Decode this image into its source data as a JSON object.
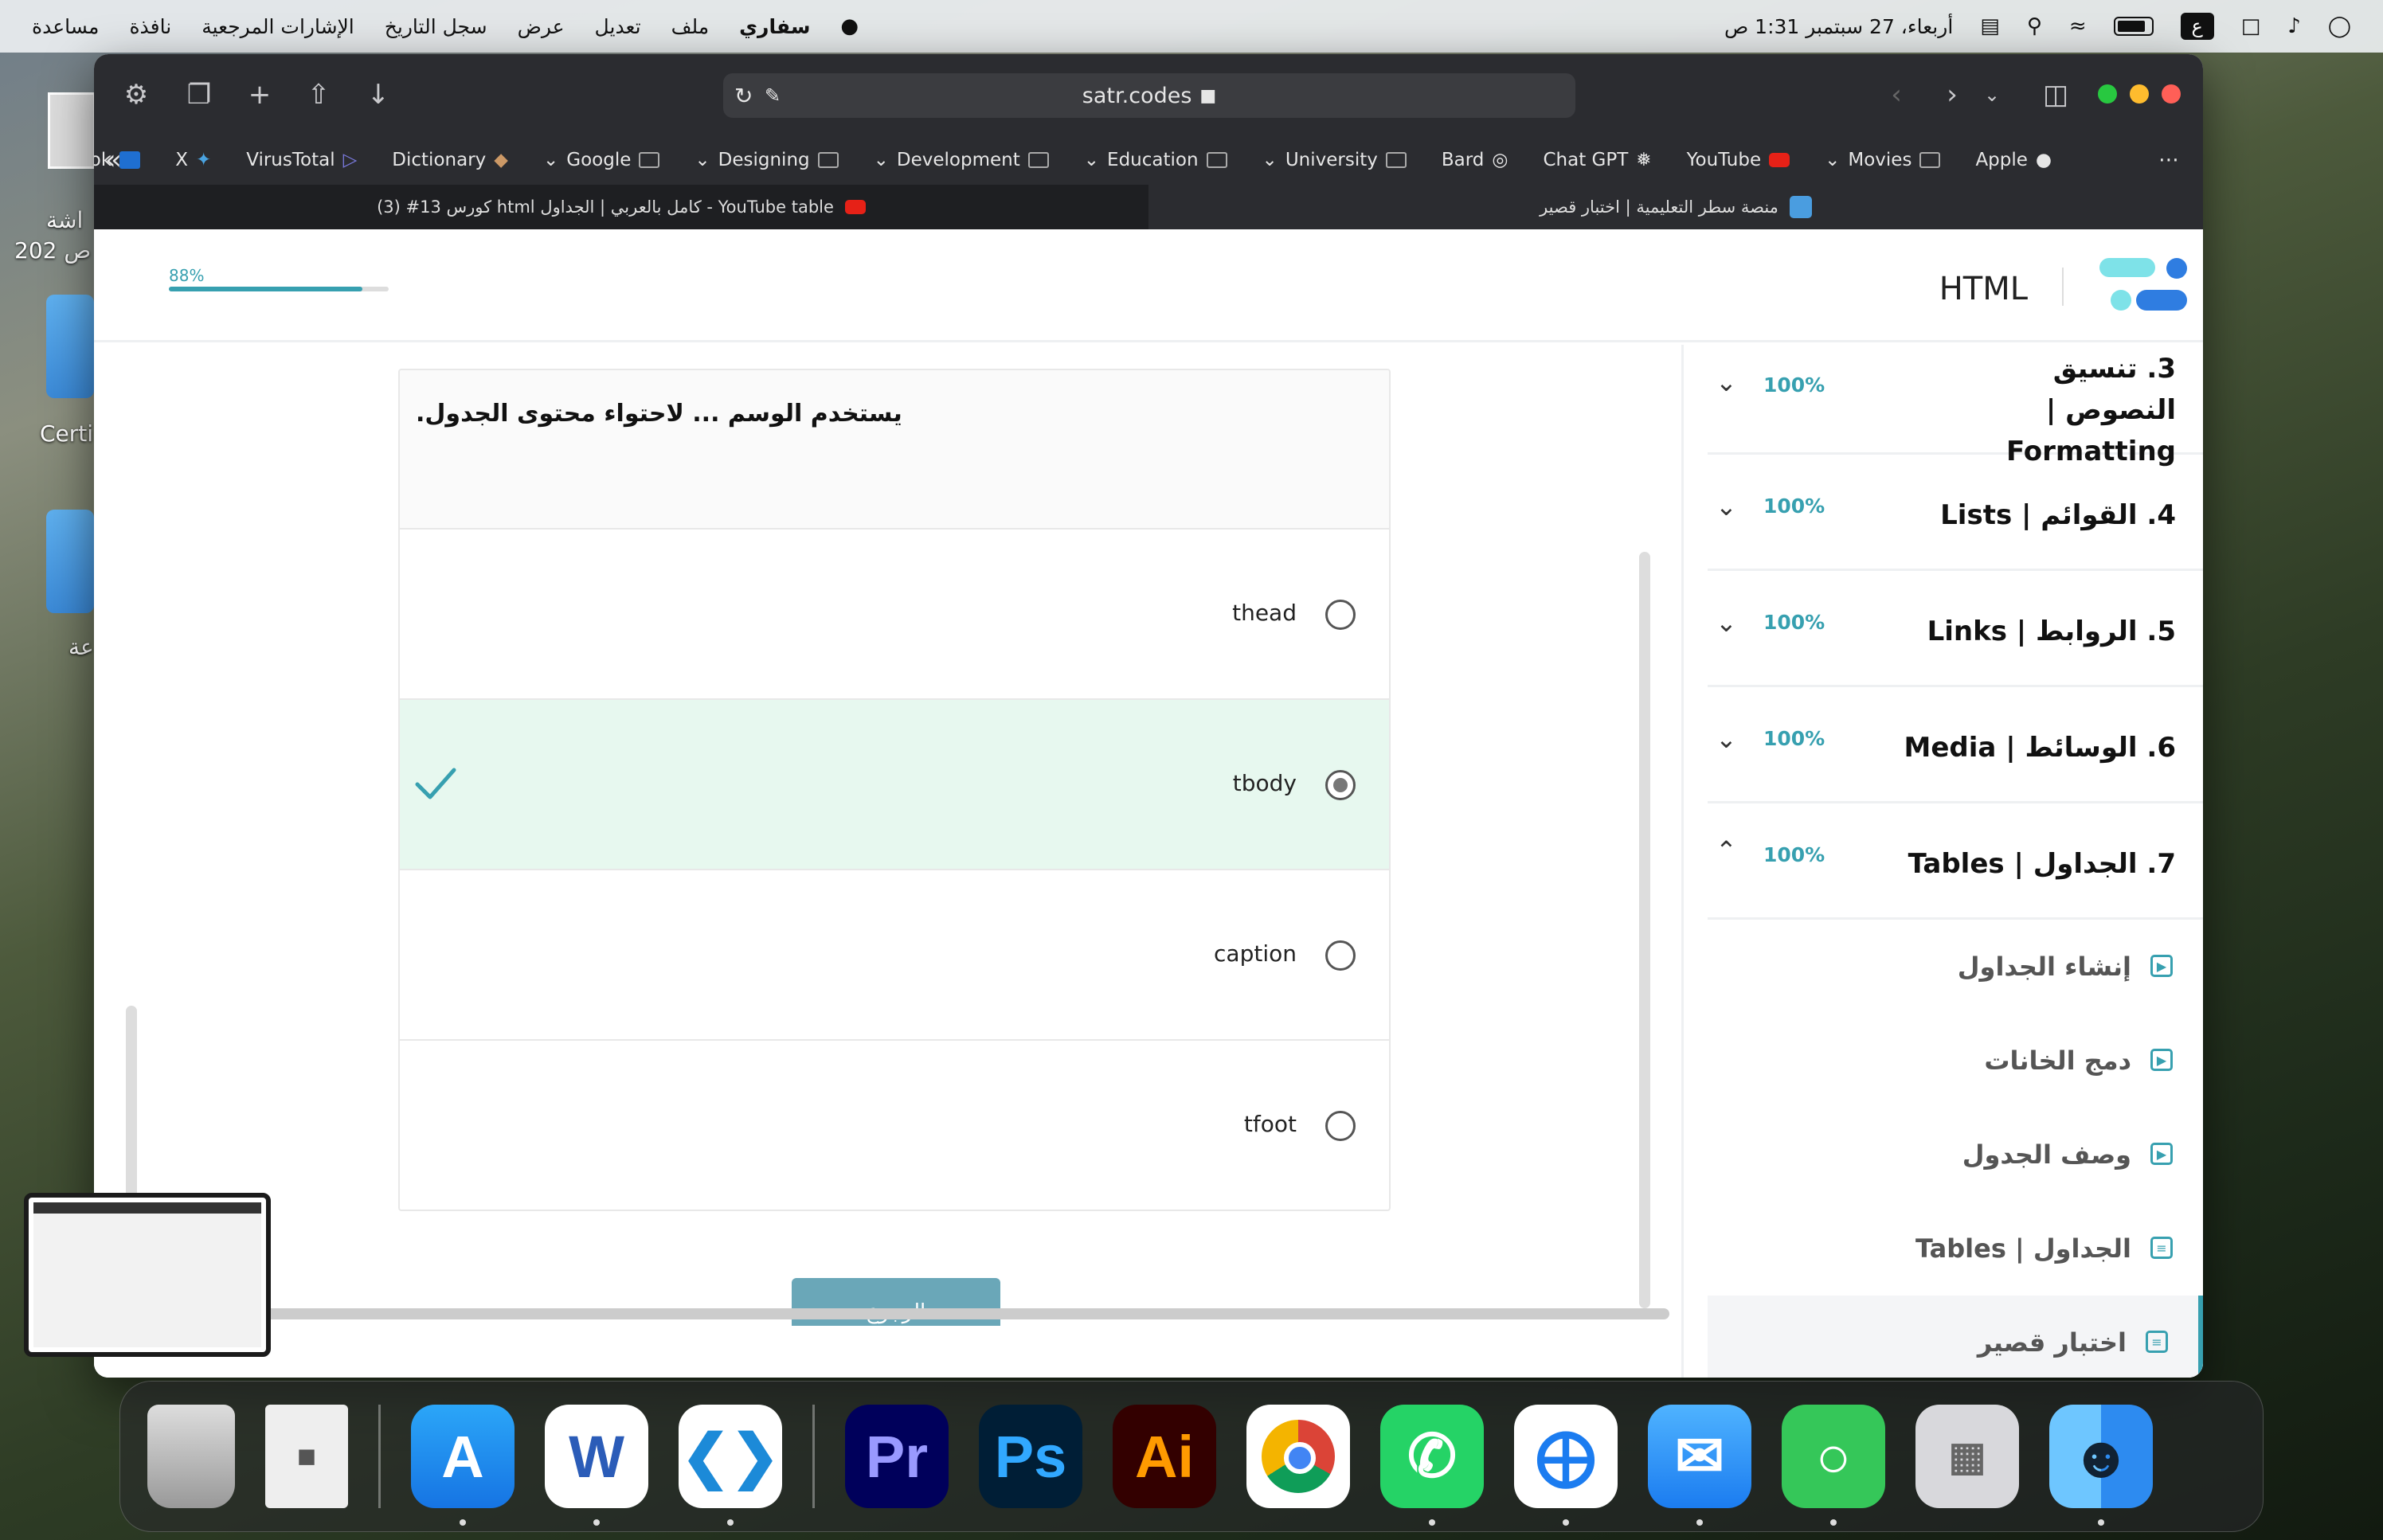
{
  "menubar": {
    "apple": "",
    "app": "سفاري",
    "items": [
      "ملف",
      "تعديل",
      "عرض",
      "سجل التاريخ",
      "الإشارات المرجعية",
      "نافذة",
      "مساعدة"
    ],
    "input_lang": "ع",
    "clock": "أربعاء، 27 سبتمبر  1:31 ص"
  },
  "desktop": {
    "label_1": "Certi",
    "label_2": "اشة",
    "label_3": "202 ص",
    "label_4": "عة"
  },
  "browser": {
    "url": "satr.codes",
    "bookmarks": [
      {
        "label": "Apple"
      },
      {
        "label": "Movies"
      },
      {
        "label": "YouTube"
      },
      {
        "label": "Chat GPT"
      },
      {
        "label": "Bard"
      },
      {
        "label": "University"
      },
      {
        "label": "Education"
      },
      {
        "label": "Development"
      },
      {
        "label": "Designing"
      },
      {
        "label": "Google"
      },
      {
        "label": "Dictionary"
      },
      {
        "label": "VirusTotal"
      },
      {
        "label": "X"
      },
      {
        "label": "Outlook"
      }
    ],
    "tabs": [
      {
        "label": "(3) #13 كورس html كامل بالعربي | الجداول - YouTube table"
      },
      {
        "label": "منصة سطر التعليمية | اختبار قصير"
      }
    ]
  },
  "header": {
    "brand": "HTML",
    "progress_label": "88%",
    "progress": 0.88
  },
  "quiz": {
    "question": "يستخدم الوسم ... لاحتواء محتوى الجدول.",
    "options": [
      {
        "label": "thead"
      },
      {
        "label": "tbody"
      },
      {
        "label": "caption"
      },
      {
        "label": "tfoot"
      }
    ],
    "selected_index": 1,
    "back_label": "الرجوع"
  },
  "sidebar": {
    "sections": [
      {
        "title": "3. تنسيق النصوص | Formatting",
        "pct": "100%"
      },
      {
        "title": "4. القوائم | Lists",
        "pct": "100%"
      },
      {
        "title": "5. الروابط | Links",
        "pct": "100%"
      },
      {
        "title": "6. الوسائط | Media",
        "pct": "100%"
      },
      {
        "title": "7. الجداول | Tables",
        "pct": "100%"
      }
    ],
    "lessons": [
      {
        "title": "إنشاء الجداول"
      },
      {
        "title": "دمج الخانات"
      },
      {
        "title": "وصف الجدول"
      },
      {
        "title": "الجداول | Tables"
      },
      {
        "title": "اختبار قصير"
      }
    ]
  },
  "dock": {
    "ps": "Ps",
    "pr": "Pr",
    "ai": "Ai",
    "word": "W"
  },
  "colors": {
    "accent": "#37a0b0",
    "correct_bg": "#e7f8ef",
    "toolbar": "#2b2c30"
  }
}
